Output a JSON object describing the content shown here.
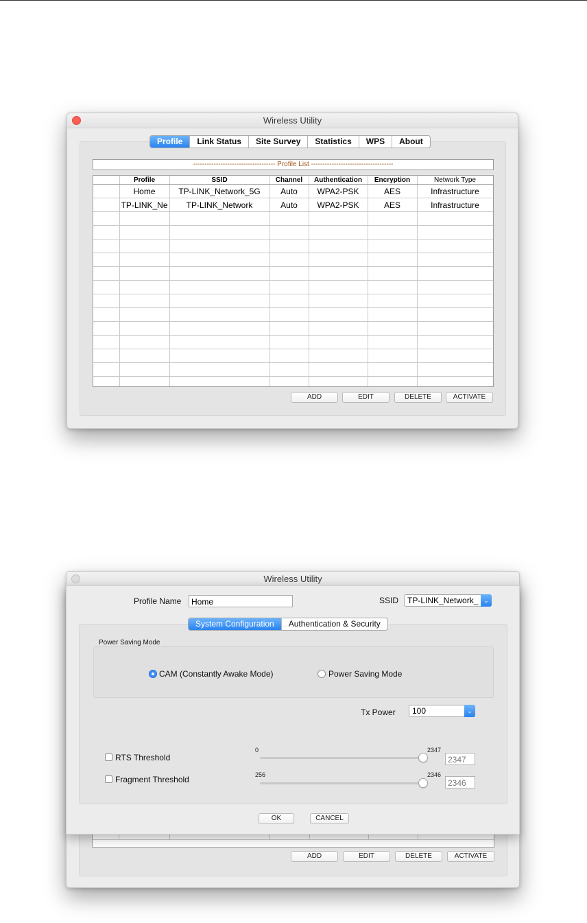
{
  "window1": {
    "title": "Wireless Utility",
    "tabs": [
      "Profile",
      "Link Status",
      "Site Survey",
      "Statistics",
      "WPS",
      "About"
    ],
    "active_tab": "Profile",
    "profile_list_title": "------------------------------------ Profile List ------------------------------------",
    "columns": [
      "Profile",
      "SSID",
      "Channel",
      "Authentication",
      "Encryption",
      "Network Type"
    ],
    "rows": [
      [
        "Home",
        "TP-LINK_Network_5G",
        "Auto",
        "WPA2-PSK",
        "AES",
        "Infrastructure"
      ],
      [
        "TP-LINK_Ne",
        "TP-LINK_Network",
        "Auto",
        "WPA2-PSK",
        "AES",
        "Infrastructure"
      ]
    ],
    "buttons": {
      "add": "ADD",
      "edit": "EDIT",
      "delete": "DELETE",
      "activate": "ACTIVATE"
    }
  },
  "window2": {
    "title": "Wireless Utility",
    "buttons": {
      "add": "ADD",
      "edit": "EDIT",
      "delete": "DELETE",
      "activate": "ACTIVATE"
    }
  },
  "dialog": {
    "profile_name_label": "Profile Name",
    "profile_name_value": "Home",
    "ssid_label": "SSID",
    "ssid_value": "TP-LINK_Network_",
    "tabs": [
      "System Configuration",
      "Authentication & Security"
    ],
    "active_tab": "System Configuration",
    "power_saving_title": "Power Saving Mode",
    "radio_cam": "CAM (Constantly Awake Mode)",
    "radio_psm": "Power Saving Mode",
    "radio_selected": "CAM (Constantly Awake Mode)",
    "tx_power_label": "Tx Power",
    "tx_power_value": "100",
    "rts": {
      "label": "RTS Threshold",
      "checked": false,
      "min": "0",
      "max": "2347",
      "value": "2347"
    },
    "fragment": {
      "label": "Fragment Threshold",
      "checked": false,
      "min": "256",
      "max": "2346",
      "value": "2346"
    },
    "ok_label": "OK",
    "cancel_label": "CANCEL"
  },
  "colors": {
    "accent": "#2a83f0",
    "close_button": "#fc5e57",
    "profile_list_title": "#a35a1a"
  }
}
